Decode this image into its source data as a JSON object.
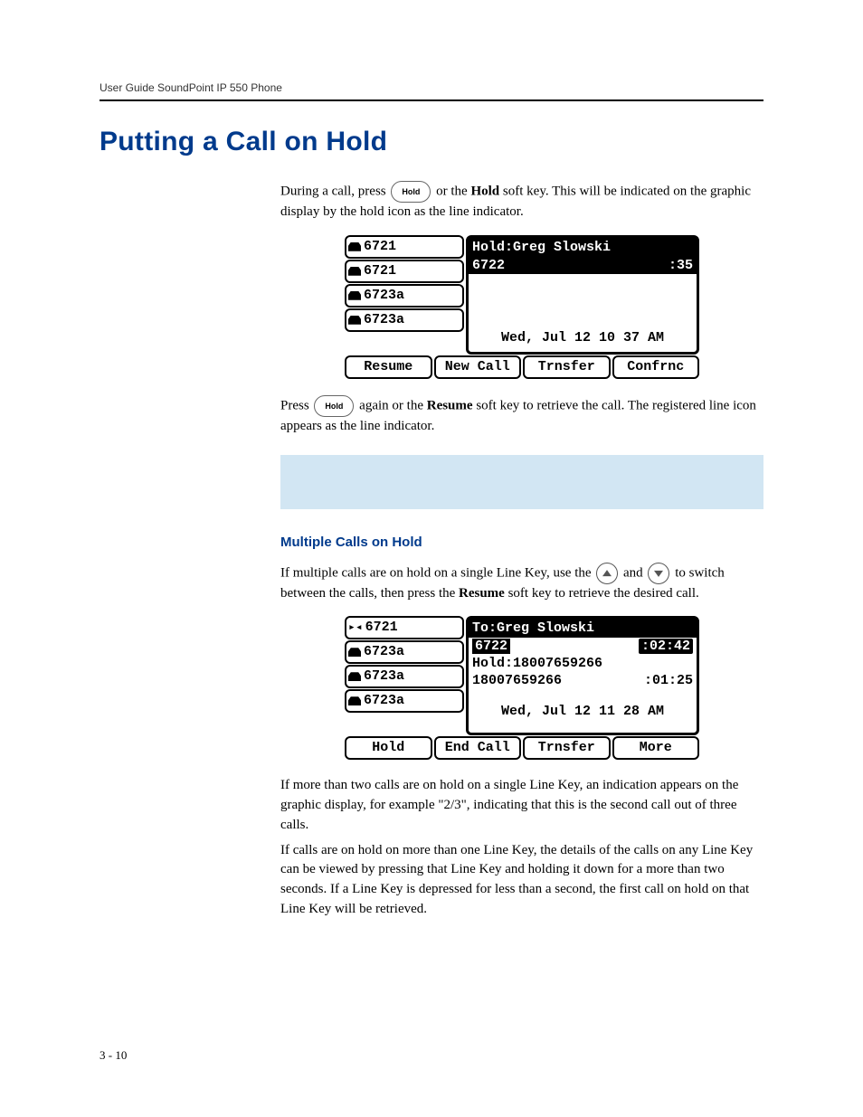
{
  "header": {
    "running": "User Guide SoundPoint IP 550 Phone"
  },
  "title": "Putting a Call on Hold",
  "buttons": {
    "hold": "Hold"
  },
  "paras": {
    "p1a": "During a call, press ",
    "p1b": " or the ",
    "p1c": "Hold",
    "p1d": " soft key. This will be indicated on the graphic display by the hold icon as the line indicator.",
    "p2a": "Press ",
    "p2b": " again or the ",
    "p2c": "Resume",
    "p2d": " soft key to retrieve the call. The registered line icon appears as the line indicator.",
    "sub": "Multiple Calls on Hold",
    "p3a": "If multiple calls are on hold on a single Line Key, use the ",
    "p3b": " and ",
    "p3c": " to switch between the calls, then press the ",
    "p3d": "Resume",
    "p3e": " soft key to retrieve the desired call.",
    "p4": "If more than two calls are on hold on a single Line Key, an indication appears on the graphic display, for example \"2/3\", indicating that this is the second call out of three calls.",
    "p5": "If calls are on hold on more than one Line Key, the details of the calls on any Line Key can be viewed by pressing that Line Key and holding it down for a more than two seconds. If a Line Key is depressed for less than a second, the first call on hold on that Line Key will be retrieved."
  },
  "lcd1": {
    "lines": [
      "6721",
      "6721",
      "6723a",
      "6723a"
    ],
    "header": "Hold:Greg Slowski",
    "row1_left": "6722",
    "row1_right": ":35",
    "datetime": "Wed, Jul 12  10 37 AM",
    "soft": [
      "Resume",
      "New Call",
      "Trnsfer",
      "Confrnc"
    ]
  },
  "lcd2": {
    "lines": [
      "6721",
      "6723a",
      "6723a",
      "6723a"
    ],
    "header": "To:Greg Slowski",
    "row1_left": "6722",
    "row1_right": ":02:42",
    "row2_left": "Hold:18007659266",
    "row3_left": "18007659266",
    "row3_right": ":01:25",
    "datetime": "Wed, Jul 12  11 28 AM",
    "soft": [
      "Hold",
      "End Call",
      "Trnsfer",
      "More"
    ]
  },
  "footer": "3 - 10"
}
